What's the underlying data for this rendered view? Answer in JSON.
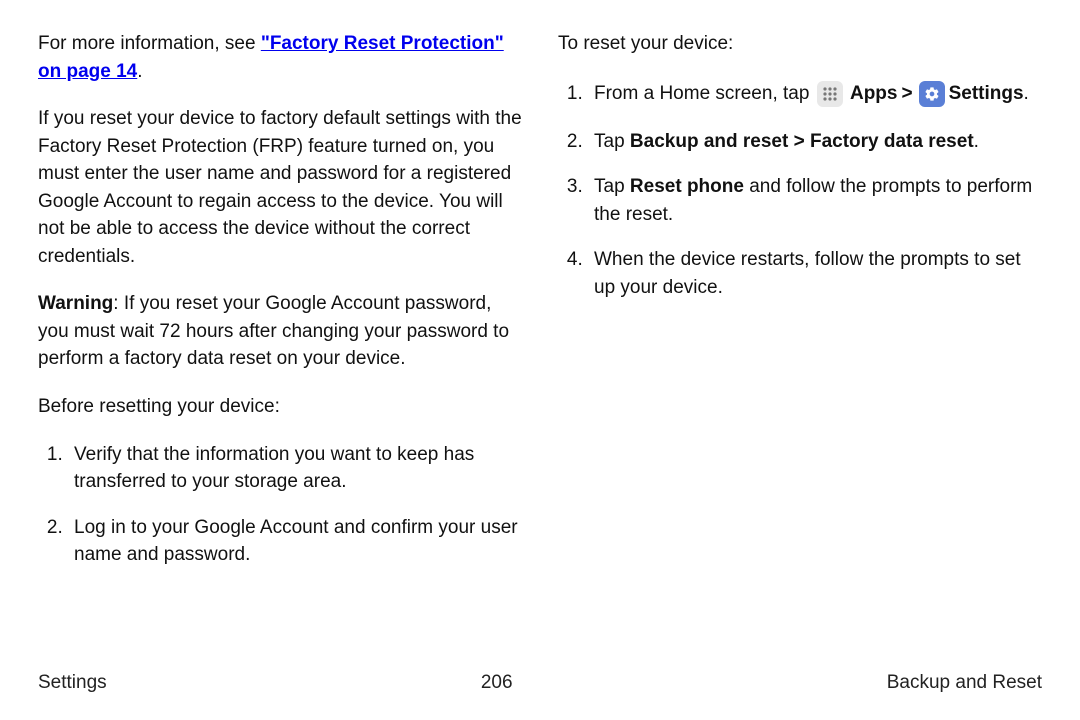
{
  "left": {
    "intro_pre": "For more information, see ",
    "intro_link": "\"Factory Reset Protection\" on page 14",
    "intro_post": ".",
    "frp_para": "If you reset your device to factory default settings with the Factory Reset Protection (FRP) feature turned on, you must enter the user name and password for a registered Google Account to regain access to the device. You will not be able to access the device without the correct credentials.",
    "warning_label": "Warning",
    "warning_text": ": If you reset your Google Account password, you must wait 72 hours after changing your password to perform a factory data reset on your device.",
    "before_heading": "Before resetting your device:",
    "before_steps": [
      "Verify that the information you want to keep has transferred to your storage area.",
      "Log in to your Google Account and confirm your user name and password."
    ]
  },
  "right": {
    "reset_heading": "To reset your device:",
    "step1_pre": "From a Home screen, tap ",
    "apps_label": "Apps",
    "chev": ">",
    "settings_label": "Settings",
    "step1_post": ".",
    "step2_pre": "Tap ",
    "step2_bold": "Backup and reset > Factory data reset",
    "step2_post": ".",
    "step3_pre": "Tap ",
    "step3_bold": "Reset phone",
    "step3_post": " and follow the prompts to perform the reset.",
    "step4": "When the device restarts, follow the prompts to set up your device."
  },
  "footer": {
    "left": "Settings",
    "center": "206",
    "right": "Backup and Reset"
  }
}
